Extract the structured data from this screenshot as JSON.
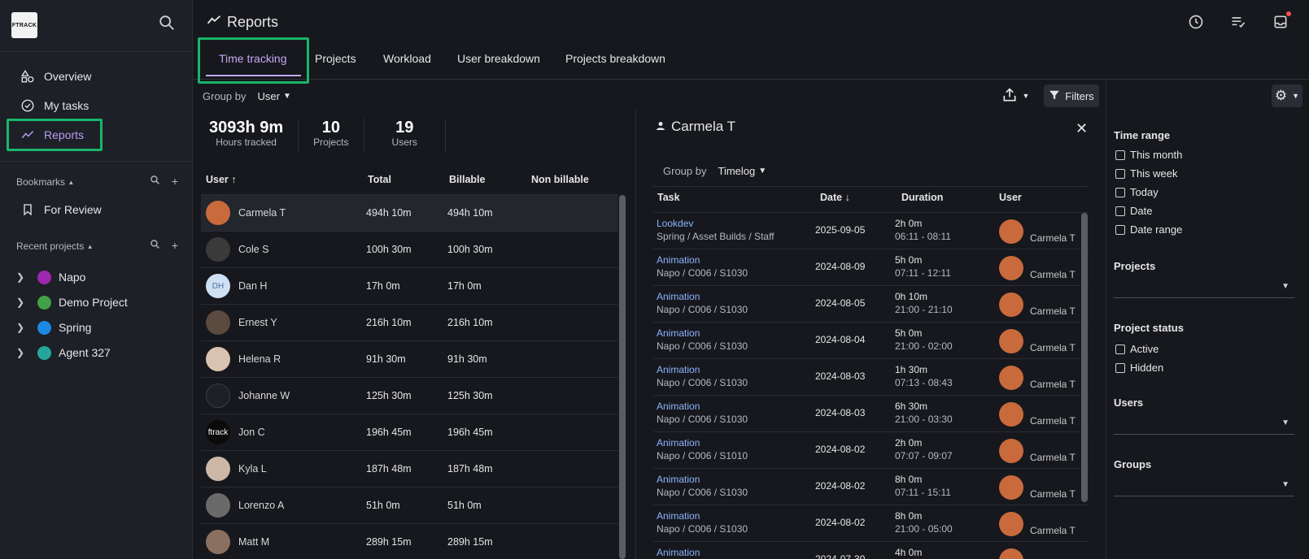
{
  "app": {
    "logo_text": "FTRACK",
    "page_title": "Reports"
  },
  "sidebar": {
    "nav": [
      {
        "label": "Overview",
        "icon": "shapes-icon"
      },
      {
        "label": "My tasks",
        "icon": "check-circle-icon"
      },
      {
        "label": "Reports",
        "icon": "trend-icon"
      }
    ],
    "bookmarks_label": "Bookmarks",
    "bookmarks": [
      {
        "label": "For Review",
        "icon": "bookmark-icon"
      }
    ],
    "recent_label": "Recent projects",
    "projects": [
      {
        "label": "Napo",
        "color": "#9c27b0"
      },
      {
        "label": "Demo Project",
        "color": "#43a047"
      },
      {
        "label": "Spring",
        "color": "#1e88e5"
      },
      {
        "label": "Agent 327",
        "color": "#26a69a"
      }
    ]
  },
  "tabs": [
    "Time tracking",
    "Projects",
    "Workload",
    "User breakdown",
    "Projects breakdown"
  ],
  "toolbar": {
    "group_by_label": "Group by",
    "group_by_value": "User",
    "filters_label": "Filters"
  },
  "stats": [
    {
      "value": "3093h 9m",
      "label": "Hours tracked"
    },
    {
      "value": "10",
      "label": "Projects"
    },
    {
      "value": "19",
      "label": "Users"
    }
  ],
  "user_table": {
    "headers": [
      "User",
      "Total",
      "Billable",
      "Non billable"
    ],
    "rows": [
      {
        "user": "Carmela T",
        "total": "494h 10m",
        "billable": "494h 10m",
        "avatar": "#c86a3c"
      },
      {
        "user": "Cole S",
        "total": "100h 30m",
        "billable": "100h 30m",
        "avatar": "#3a3a3a"
      },
      {
        "user": "Dan H",
        "total": "17h 0m",
        "billable": "17h 0m",
        "avatar": "#cfe0f5",
        "initials": "DH"
      },
      {
        "user": "Ernest Y",
        "total": "216h 10m",
        "billable": "216h 10m",
        "avatar": "#5a4a40"
      },
      {
        "user": "Helena R",
        "total": "91h 30m",
        "billable": "91h 30m",
        "avatar": "#d8c2b0"
      },
      {
        "user": "Johanne W",
        "total": "125h 30m",
        "billable": "125h 30m",
        "avatar": "#1d2027"
      },
      {
        "user": "Jon C",
        "total": "196h 45m",
        "billable": "196h 45m",
        "avatar": "#0b0b0b",
        "initials": "ftrack"
      },
      {
        "user": "Kyla L",
        "total": "187h 48m",
        "billable": "187h 48m",
        "avatar": "#cdb8a8"
      },
      {
        "user": "Lorenzo A",
        "total": "51h 0m",
        "billable": "51h 0m",
        "avatar": "#6a6a6a"
      },
      {
        "user": "Matt M",
        "total": "289h 15m",
        "billable": "289h 15m",
        "avatar": "#8a7060"
      }
    ]
  },
  "detail": {
    "user": "Carmela T",
    "group_by_label": "Group by",
    "group_by_value": "Timelog",
    "headers": [
      "Task",
      "Date",
      "Duration",
      "User"
    ],
    "rows": [
      {
        "task": "Lookdev",
        "path": "Spring / Asset Builds / Staff",
        "date": "2025-09-05",
        "duration": "2h 0m",
        "range": "06:11 - 08:11",
        "user": "Carmela T"
      },
      {
        "task": "Animation",
        "path": "Napo / C006 / S1030",
        "date": "2024-08-09",
        "duration": "5h 0m",
        "range": "07:11 - 12:11",
        "user": "Carmela T"
      },
      {
        "task": "Animation",
        "path": "Napo / C006 / S1030",
        "date": "2024-08-05",
        "duration": "0h 10m",
        "range": "21:00 - 21:10",
        "user": "Carmela T"
      },
      {
        "task": "Animation",
        "path": "Napo / C006 / S1030",
        "date": "2024-08-04",
        "duration": "5h 0m",
        "range": "21:00 - 02:00",
        "user": "Carmela T"
      },
      {
        "task": "Animation",
        "path": "Napo / C006 / S1030",
        "date": "2024-08-03",
        "duration": "1h 30m",
        "range": "07:13 - 08:43",
        "user": "Carmela T"
      },
      {
        "task": "Animation",
        "path": "Napo / C006 / S1030",
        "date": "2024-08-03",
        "duration": "6h 30m",
        "range": "21:00 - 03:30",
        "user": "Carmela T"
      },
      {
        "task": "Animation",
        "path": "Napo / C006 / S1010",
        "date": "2024-08-02",
        "duration": "2h 0m",
        "range": "07:07 - 09:07",
        "user": "Carmela T"
      },
      {
        "task": "Animation",
        "path": "Napo / C006 / S1030",
        "date": "2024-08-02",
        "duration": "8h 0m",
        "range": "07:11 - 15:11",
        "user": "Carmela T"
      },
      {
        "task": "Animation",
        "path": "Napo / C006 / S1030",
        "date": "2024-08-02",
        "duration": "8h 0m",
        "range": "21:00 - 05:00",
        "user": "Carmela T"
      },
      {
        "task": "Animation",
        "path": "",
        "date": "2024-07-30",
        "duration": "4h 0m",
        "range": "",
        "user": ""
      }
    ]
  },
  "filters": {
    "time_range_title": "Time range",
    "time_range": [
      "This month",
      "This week",
      "Today",
      "Date",
      "Date range"
    ],
    "projects_title": "Projects",
    "project_status_title": "Project status",
    "project_status": [
      "Active",
      "Hidden"
    ],
    "users_title": "Users",
    "groups_title": "Groups"
  }
}
